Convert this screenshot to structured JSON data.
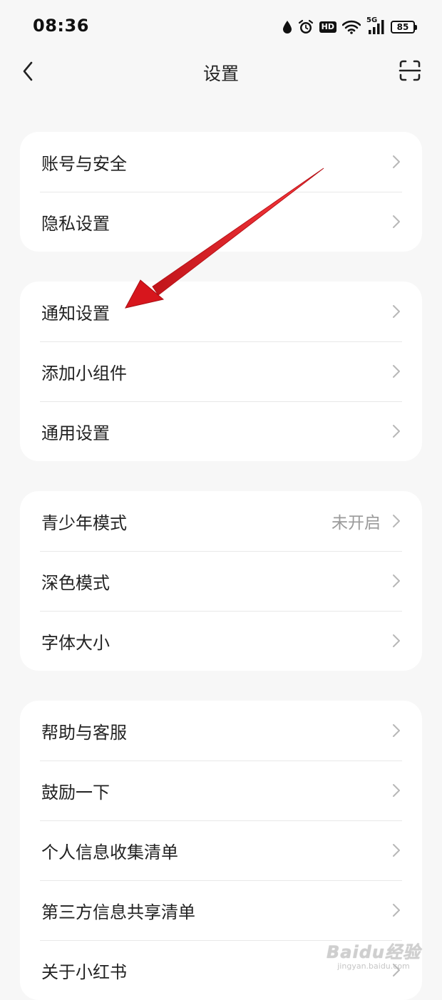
{
  "status_bar": {
    "time": "08:36",
    "hd": "HD",
    "network": "5G",
    "battery": "85"
  },
  "header": {
    "title": "设置"
  },
  "groups": [
    {
      "items": [
        {
          "label": "账号与安全"
        },
        {
          "label": "隐私设置"
        }
      ]
    },
    {
      "items": [
        {
          "label": "通知设置"
        },
        {
          "label": "添加小组件"
        },
        {
          "label": "通用设置"
        }
      ]
    },
    {
      "items": [
        {
          "label": "青少年模式",
          "value": "未开启"
        },
        {
          "label": "深色模式"
        },
        {
          "label": "字体大小"
        }
      ]
    },
    {
      "items": [
        {
          "label": "帮助与客服"
        },
        {
          "label": "鼓励一下"
        },
        {
          "label": "个人信息收集清单"
        },
        {
          "label": "第三方信息共享清单"
        },
        {
          "label": "关于小红书"
        }
      ]
    }
  ],
  "annotation": {
    "color": "#e11b22",
    "points_to": "通知设置"
  },
  "watermark": {
    "brand": "Baidu经验",
    "url": "jingyan.baidu.com"
  }
}
